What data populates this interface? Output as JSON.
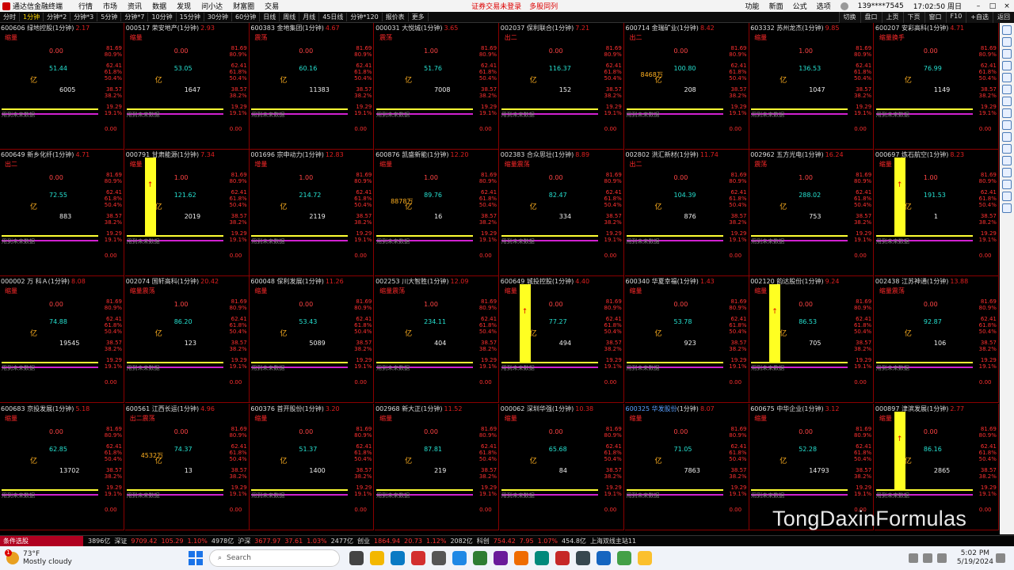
{
  "topbar": {
    "app_title": "通达信金融终端",
    "menus": [
      "行情",
      "市场",
      "资讯",
      "数据",
      "发现",
      "问小达",
      "财富圈",
      "交易"
    ],
    "status_left": "证券交易未登录",
    "status_right": "多股同列",
    "right": [
      "功能",
      "新面",
      "公式",
      "选项"
    ],
    "account": "139****7545",
    "clock": "17:02:50 周日"
  },
  "periodbar": {
    "periods": [
      "分时",
      "1分钟",
      "分钟*2",
      "分钟*3",
      "5分钟",
      "分钟*7",
      "10分钟",
      "15分钟",
      "30分钟",
      "60分钟",
      "日线",
      "周线",
      "月线",
      "45日线",
      "分钟*120",
      "报价表",
      "更多"
    ],
    "active": "1分钟",
    "right": [
      "切换",
      "盘口",
      "上页",
      "下页",
      "窗口",
      "F10",
      "+自选",
      "返回"
    ]
  },
  "common": {
    "scale_top": [
      "81.69",
      "80.9%"
    ],
    "scale_mid": [
      "62.41",
      "61.8%",
      "50.4%"
    ],
    "scale_low": [
      "38.57",
      "38.2%"
    ],
    "scale_bot": [
      "19.29",
      "19.1%"
    ],
    "zero": "0.00",
    "yi": "亿",
    "no_future": "用到未来数据"
  },
  "panels": [
    {
      "code": "600606",
      "name": "绿地控股",
      "period": "(1分钟)",
      "price": "2.17",
      "tag": "缩量",
      "v1": "0.00",
      "v2": "51.44",
      "v3": "6005"
    },
    {
      "code": "000517",
      "name": "荣安地产",
      "period": "(1分钟)",
      "price": "2.93",
      "tag": "缩量",
      "v1": "0.00",
      "v2": "53.05",
      "v3": "1647"
    },
    {
      "code": "600383",
      "name": "金地集团",
      "period": "(1分钟)",
      "price": "4.67",
      "tag": "震荡",
      "v1": "0.00",
      "v2": "60.16",
      "v3": "11383"
    },
    {
      "code": "000031",
      "name": "大悦城",
      "period": "(1分钟)",
      "price": "3.65",
      "tag": "震荡",
      "v1": "1.00",
      "v2": "51.76",
      "v3": "7008"
    },
    {
      "code": "002037",
      "name": "保利联合",
      "period": "(1分钟)",
      "price": "7.21",
      "tag": "出二",
      "v1": "0.00",
      "v2": "116.37",
      "v3": "152"
    },
    {
      "code": "600714",
      "name": "金瑞矿业",
      "period": "(1分钟)",
      "price": "8.42",
      "tag": "出二",
      "v1": "0.00",
      "v2": "100.80",
      "v3": "208",
      "extra": "8468万"
    },
    {
      "code": "603332",
      "name": "苏州龙杰",
      "period": "(1分钟)",
      "price": "9.85",
      "tag": "缩量",
      "v1": "1.00",
      "v2": "136.53",
      "v3": "1047"
    },
    {
      "code": "600207",
      "name": "安彩高科",
      "period": "(1分钟)",
      "price": "4.71",
      "tag": "缩量换手",
      "v1": "0.00",
      "v2": "76.99",
      "v3": "1149"
    },
    {
      "code": "600649",
      "name": "新乡化纤",
      "period": "(1分钟)",
      "price": "4.71",
      "tag": "出二",
      "v1": "0.00",
      "v2": "72.55",
      "v3": "883"
    },
    {
      "code": "000791",
      "name": "甘肃能源",
      "period": "(1分钟)",
      "price": "7.34",
      "tag": "缩量",
      "v1": "1.00",
      "v2": "121.62",
      "v3": "2019",
      "bar": true
    },
    {
      "code": "001696",
      "name": "宗申动力",
      "period": "(1分钟)",
      "price": "12.83",
      "tag": "增量",
      "v1": "1.00",
      "v2": "214.72",
      "v3": "2119"
    },
    {
      "code": "600876",
      "name": "凯盛新能",
      "period": "(1分钟)",
      "price": "12.20",
      "tag": "缩量",
      "v1": "1.00",
      "v2": "89.76",
      "v3": "16",
      "extra": "8878万"
    },
    {
      "code": "002383",
      "name": "合众思壮",
      "period": "(1分钟)",
      "price": "8.89",
      "tag": "缩量震荡",
      "v1": "0.00",
      "v2": "82.47",
      "v3": "334"
    },
    {
      "code": "002802",
      "name": "洪汇新材",
      "period": "(1分钟)",
      "price": "11.74",
      "tag": "出二",
      "v1": "0.00",
      "v2": "104.39",
      "v3": "876"
    },
    {
      "code": "002962",
      "name": "五方光电",
      "period": "(1分钟)",
      "price": "16.24",
      "tag": "震荡",
      "v1": "1.00",
      "v2": "288.02",
      "v3": "753"
    },
    {
      "code": "000697",
      "name": "炼石航空",
      "period": "(1分钟)",
      "price": "8.23",
      "tag": "缩量",
      "v1": "1.00",
      "v2": "191.53",
      "v3": "1",
      "bar": true
    },
    {
      "code": "000002",
      "name": "万 科Ａ",
      "period": "(1分钟)",
      "price": "8.08",
      "tag": "缩量",
      "v1": "0.00",
      "v2": "74.88",
      "v3": "19545"
    },
    {
      "code": "002074",
      "name": "国轩高科",
      "period": "(1分钟)",
      "price": "20.42",
      "tag": "缩量震荡",
      "v1": "1.00",
      "v2": "86.20",
      "v3": "123"
    },
    {
      "code": "600048",
      "name": "保利发展",
      "period": "(1分钟)",
      "price": "11.26",
      "tag": "缩量",
      "v1": "0.00",
      "v2": "53.43",
      "v3": "5089"
    },
    {
      "code": "002253",
      "name": "川大智胜",
      "period": "(1分钟)",
      "price": "12.09",
      "tag": "缩量震荡",
      "v1": "1.00",
      "v2": "234.11",
      "v3": "404"
    },
    {
      "code": "600649",
      "name": "城投控股",
      "period": "(1分钟)",
      "price": "4.40",
      "tag": "缩量",
      "v1": "0.00",
      "v2": "77.27",
      "v3": "494",
      "bar": true
    },
    {
      "code": "600340",
      "name": "华夏幸福",
      "period": "(1分钟)",
      "price": "1.43",
      "tag": "缩量",
      "v1": "0.00",
      "v2": "53.78",
      "v3": "923"
    },
    {
      "code": "002120",
      "name": "韵达股份",
      "period": "(1分钟)",
      "price": "9.24",
      "tag": "缩量",
      "v1": "0.00",
      "v2": "86.53",
      "v3": "705",
      "bar": true
    },
    {
      "code": "002438",
      "name": "江苏神通",
      "period": "(1分钟)",
      "price": "13.88",
      "tag": "缩量震荡",
      "v1": "0.00",
      "v2": "92.87",
      "v3": "106"
    },
    {
      "code": "600683",
      "name": "京投发展",
      "period": "(1分钟)",
      "price": "5.18",
      "tag": "缩量",
      "v1": "0.00",
      "v2": "62.85",
      "v3": "13702"
    },
    {
      "code": "600561",
      "name": "江西长运",
      "period": "(1分钟)",
      "price": "4.96",
      "tag": "出二震荡",
      "v1": "0.00",
      "v2": "74.37",
      "v3": "13",
      "extra": "4532万"
    },
    {
      "code": "600376",
      "name": "首开股份",
      "period": "(1分钟)",
      "price": "3.20",
      "tag": "缩量",
      "v1": "0.00",
      "v2": "51.37",
      "v3": "1400"
    },
    {
      "code": "002968",
      "name": "新大正",
      "period": "(1分钟)",
      "price": "11.52",
      "tag": "缩量",
      "v1": "0.00",
      "v2": "87.81",
      "v3": "219"
    },
    {
      "code": "000062",
      "name": "深圳华强",
      "period": "(1分钟)",
      "price": "10.38",
      "tag": "缩量",
      "v1": "0.00",
      "v2": "65.68",
      "v3": "84"
    },
    {
      "code": "600325",
      "name": "华发股份",
      "period": "(1分钟)",
      "price": "8.07",
      "tag": "缩量",
      "v1": "0.00",
      "v2": "71.05",
      "v3": "7863",
      "hl": true
    },
    {
      "code": "600675",
      "name": "中华企业",
      "period": "(1分钟)",
      "price": "3.12",
      "tag": "缩量",
      "v1": "0.00",
      "v2": "52.28",
      "v3": "14793"
    },
    {
      "code": "000897",
      "name": "津滨发展",
      "period": "(1分钟)",
      "price": "2.77",
      "tag": "缩量",
      "v1": "0.00",
      "v2": "86.16",
      "v3": "2865",
      "bar": true
    }
  ],
  "statusbar": {
    "cond": "条件选股",
    "items": [
      {
        "t": "3896亿",
        "c": ""
      },
      {
        "t": "深证",
        "c": ""
      },
      {
        "t": "9709.42",
        "c": "r"
      },
      {
        "t": "105.29",
        "c": "r"
      },
      {
        "t": "1.10%",
        "c": "r"
      },
      {
        "t": "4978亿",
        "c": ""
      },
      {
        "t": "沪深",
        "c": ""
      },
      {
        "t": "3677.97",
        "c": "r"
      },
      {
        "t": "37.61",
        "c": "r"
      },
      {
        "t": "1.03%",
        "c": "r"
      },
      {
        "t": "2477亿",
        "c": ""
      },
      {
        "t": "创业",
        "c": ""
      },
      {
        "t": "1864.94",
        "c": "r"
      },
      {
        "t": "20.73",
        "c": "r"
      },
      {
        "t": "1.12%",
        "c": "r"
      },
      {
        "t": "2082亿",
        "c": ""
      },
      {
        "t": "科创",
        "c": ""
      },
      {
        "t": "754.42",
        "c": "r"
      },
      {
        "t": "7.95",
        "c": "r"
      },
      {
        "t": "1.07%",
        "c": "r"
      },
      {
        "t": "454.8亿",
        "c": ""
      },
      {
        "t": "上海双线主站11",
        "c": ""
      }
    ]
  },
  "watermark": "TongDaxinFormulas",
  "taskbar": {
    "temp": "73°F",
    "weather": "Mostly cloudy",
    "badge": "1",
    "search": "Search",
    "time": "5:02 PM",
    "date": "5/19/2024"
  }
}
